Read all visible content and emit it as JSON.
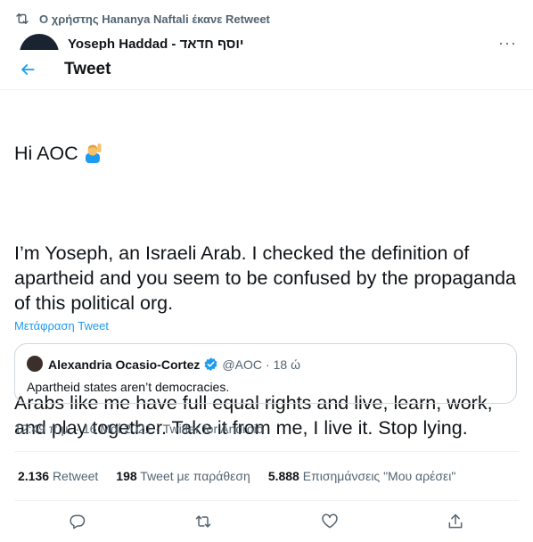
{
  "retweet_context": {
    "text": "Ο χρήστης Hananya Naftali έκανε Retweet"
  },
  "behind_author": {
    "name": "Yoseph Haddad - יוסף חדאד"
  },
  "header": {
    "title": "Tweet"
  },
  "tweet": {
    "greeting": "Hi AOC",
    "paragraph1": "I’m Yoseph, an Israeli Arab. I checked the definition of apartheid and you seem to be confused by the propaganda of this political org.",
    "paragraph2": "Arabs like me have full equal rights and live, learn, work, and play together. Take it from me, I live it. Stop lying.",
    "translate_label": "Μετάφραση Tweet"
  },
  "quote": {
    "name": "Alexandria Ocasio-Cortez",
    "handle": "@AOC",
    "separator": "·",
    "time": "18 ώ",
    "text": "Apartheid states aren’t democracies."
  },
  "timestamp": "12:49 π.μ. · 16 Μαΐ 2021 · Twitter for Android",
  "stats": {
    "retweets_count": "2.136",
    "retweets_label": "Retweet",
    "quotes_count": "198",
    "quotes_label": "Tweet με παράθεση",
    "likes_count": "5.888",
    "likes_label": "Επισημάνσεις \"Μου αρέσει\""
  },
  "colors": {
    "accent": "#1d9bf0",
    "text": "#0f1419",
    "secondary": "#536471",
    "border": "#cfd9de"
  },
  "icons": {
    "retweet_context": "retweet-icon",
    "back": "arrow-left-icon",
    "verified": "verified-badge-icon",
    "emoji": "person-raising-hand-emoji",
    "reply": "reply-icon",
    "retweet": "retweet-icon",
    "like": "heart-icon",
    "share": "share-icon"
  }
}
